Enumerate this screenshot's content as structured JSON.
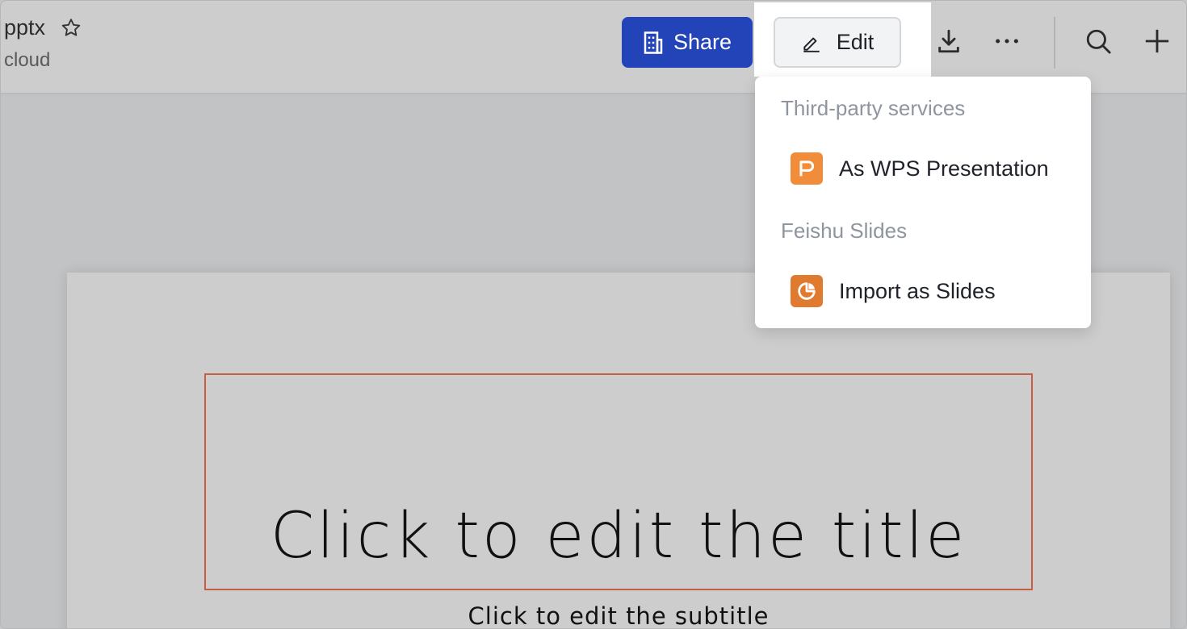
{
  "header": {
    "file_name": "pptx",
    "location": "cloud",
    "share_label": "Share",
    "edit_label": "Edit"
  },
  "dropdown": {
    "groups": [
      {
        "title": "Third-party services",
        "items": [
          {
            "label": "As WPS Presentation",
            "icon": "wps-presentation-icon"
          }
        ]
      },
      {
        "title": "Feishu Slides",
        "items": [
          {
            "label": "Import as Slides",
            "icon": "feishu-slides-icon"
          }
        ]
      }
    ]
  },
  "slide": {
    "title_placeholder": "Click to edit the title",
    "subtitle_placeholder": "Click to edit the subtitle"
  },
  "colors": {
    "share_button": "#2244b8",
    "wps_icon": "#f08c3a",
    "slides_icon": "#e07a2e",
    "title_box_border": "#c75d45"
  }
}
